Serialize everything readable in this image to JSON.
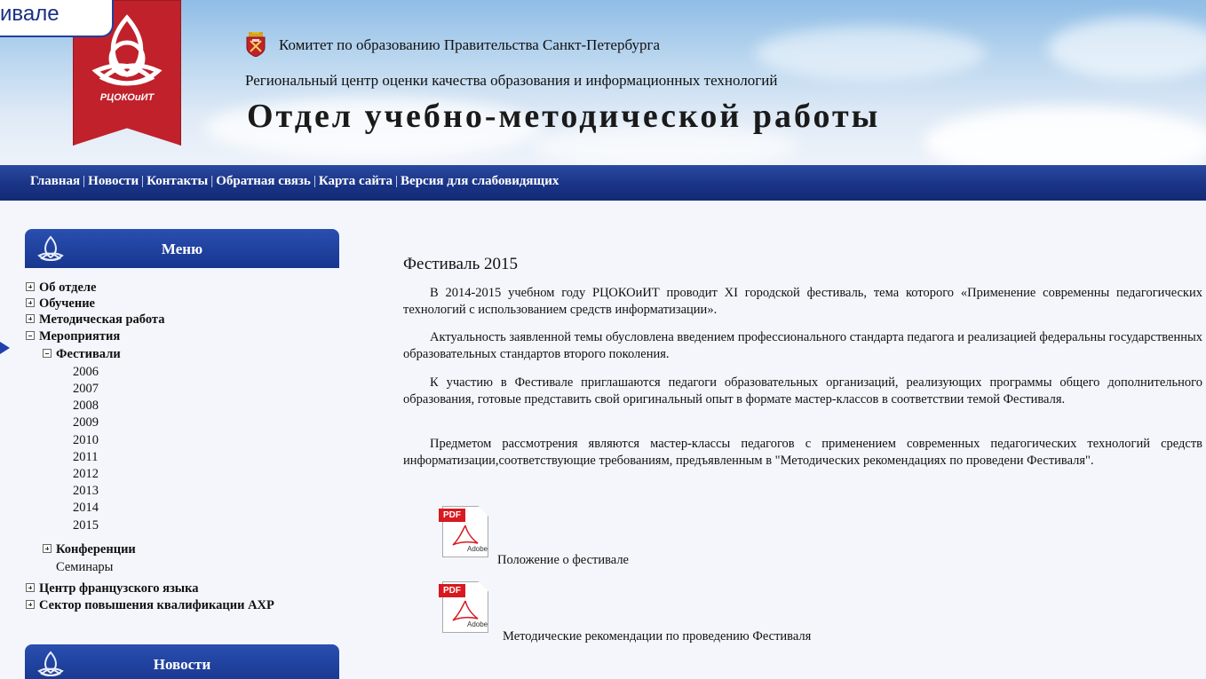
{
  "callout": {
    "text": "ивале"
  },
  "header": {
    "logo_text": "РЦОКОиИТ",
    "committee": "Комитет по образованию Правительства Санкт-Петербурга",
    "center": "Региональный центр оценки качества образования и информационных технологий",
    "title": "Отдел учебно-методической работы"
  },
  "nav": {
    "items": [
      "Главная",
      "Новости",
      "Контакты",
      "Обратная связь",
      "Карта сайта",
      "Версия для слабовидящих"
    ],
    "separator": "|"
  },
  "sidebar": {
    "menu_title": "Меню",
    "news_title": "Новости",
    "items": [
      {
        "label": "Об отделе",
        "state": "collapsed"
      },
      {
        "label": "Обучение",
        "state": "collapsed"
      },
      {
        "label": "Методическая работа",
        "state": "collapsed"
      },
      {
        "label": "Мероприятия",
        "state": "expanded"
      },
      {
        "label": "Фестивали",
        "state": "expanded"
      },
      {
        "label": "Конференции",
        "state": "collapsed"
      },
      {
        "label": "Семинары",
        "state": "leaf"
      },
      {
        "label": "Центр французского языка",
        "state": "collapsed"
      },
      {
        "label": "Сектор повышения квалификации АХР",
        "state": "collapsed"
      }
    ],
    "years": [
      "2006",
      "2007",
      "2008",
      "2009",
      "2010",
      "2011",
      "2012",
      "2013",
      "2014",
      "2015"
    ]
  },
  "content": {
    "title": "Фестиваль 2015",
    "paragraphs": [
      "В 2014-2015 учебном году РЦОКОиИТ проводит XI городской фестиваль, тема которого «Применение современны педагогических технологий с использованием средств информатизации».",
      "Актуальность заявленной темы обусловлена введением профессионального стандарта педагога и реализацией федеральны государственных образовательных стандартов второго поколения.",
      "К участию в Фестивале приглашаются педагоги образовательных организаций, реализующих программы общего дополнительного образования, готовые представить свой оригинальный опыт в формате мастер-классов в соответствии темой Фестиваля.",
      "Предметом рассмотрения являются мастер-классы педагогов с применением современных педагогических технологий средств информатизации,соответствующие требованиям, предъявленным в \"Методических рекомендациях по проведени Фестиваля\"."
    ],
    "pdf_badge": "PDF",
    "pdf_brand": "Adobe",
    "documents": [
      "Положение о фестивале",
      "Методические рекомендации по проведению Фестиваля"
    ]
  },
  "colors": {
    "nav_blue": "#1a3486",
    "ribbon_red": "#c0212b",
    "pdf_red": "#d71920"
  }
}
